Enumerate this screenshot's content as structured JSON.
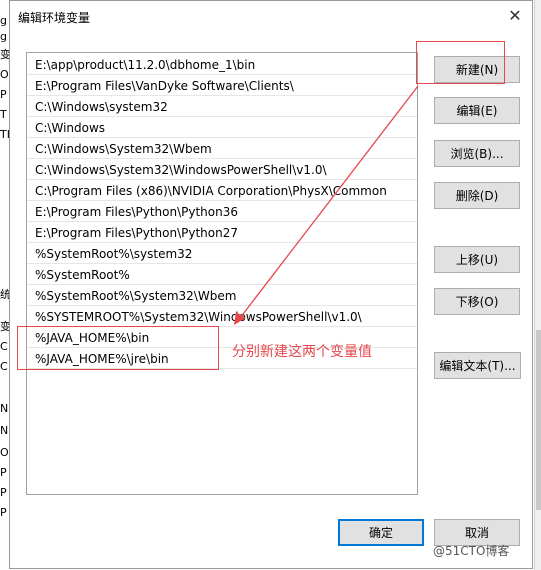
{
  "background_window": {
    "left_fragments": [
      "g",
      "g",
      "",
      "变",
      "O",
      "P",
      "T",
      "TI",
      "",
      "统",
      "",
      "变",
      "C",
      "C",
      "N",
      "N",
      "O",
      "P",
      "P",
      "P"
    ],
    "watermark": "@51CTO博客"
  },
  "dialog": {
    "title": "编辑环境变量",
    "close_glyph": "✕",
    "entries": [
      "E:\\app\\product\\11.2.0\\dbhome_1\\bin",
      "E:\\Program Files\\VanDyke Software\\Clients\\",
      "C:\\Windows\\system32",
      "C:\\Windows",
      "C:\\Windows\\System32\\Wbem",
      "C:\\Windows\\System32\\WindowsPowerShell\\v1.0\\",
      "C:\\Program Files (x86)\\NVIDIA Corporation\\PhysX\\Common",
      "E:\\Program Files\\Python\\Python36",
      "E:\\Program Files\\Python\\Python27",
      "%SystemRoot%\\system32",
      "%SystemRoot%",
      "%SystemRoot%\\System32\\Wbem",
      "%SYSTEMROOT%\\System32\\WindowsPowerShell\\v1.0\\",
      "%JAVA_HOME%\\bin",
      "%JAVA_HOME%\\jre\\bin"
    ],
    "buttons": {
      "new": "新建(N)",
      "edit": "编辑(E)",
      "browse": "浏览(B)...",
      "delete": "删除(D)",
      "move_up": "上移(U)",
      "move_down": "下移(O)",
      "edit_text": "编辑文本(T)...",
      "ok": "确定",
      "cancel": "取消"
    }
  },
  "annotation": {
    "note": "分别新建这两个变量值",
    "color": "#e5484d"
  }
}
